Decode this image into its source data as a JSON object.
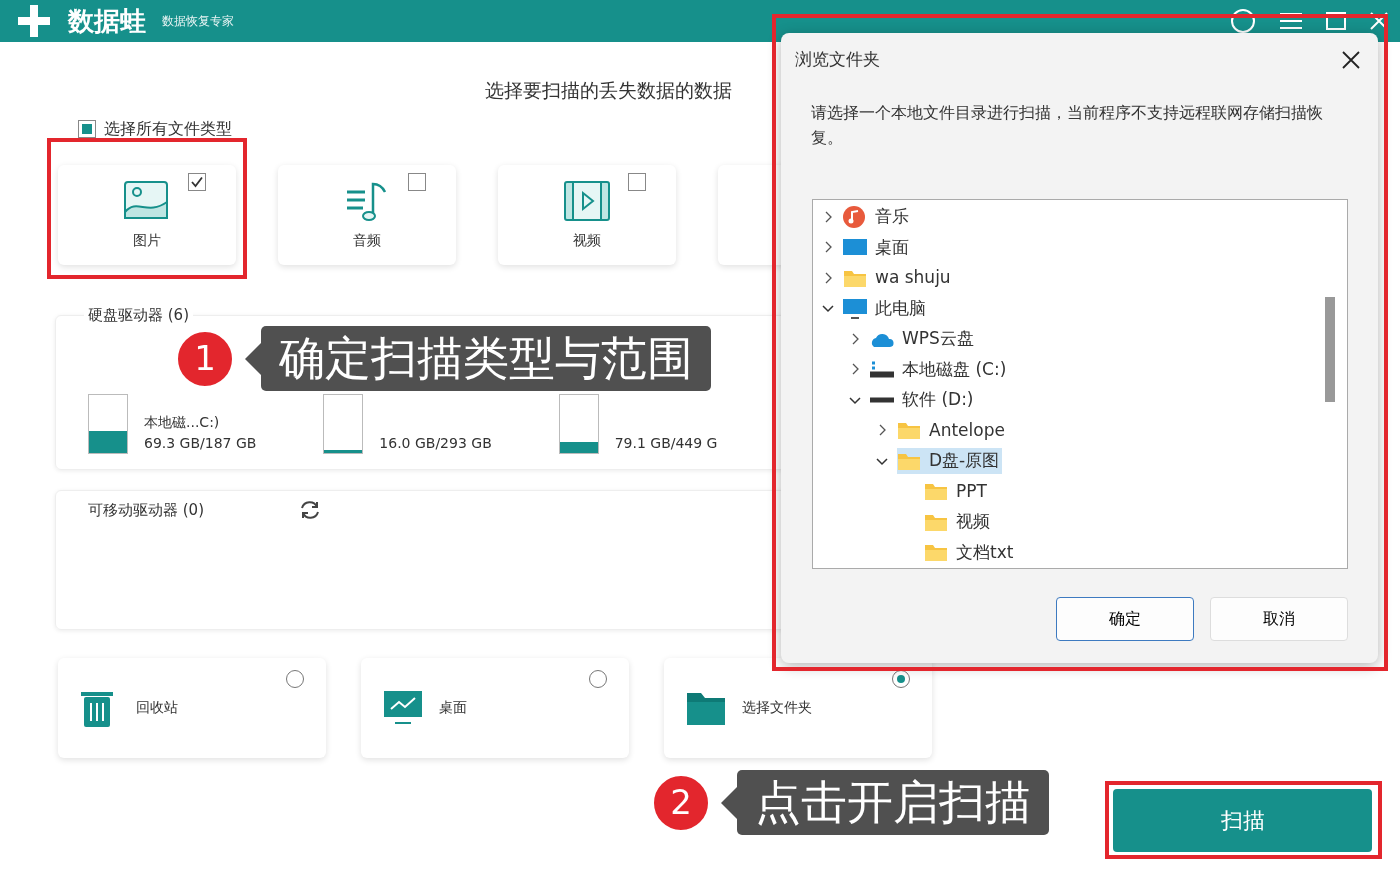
{
  "app": {
    "logo": "数据蛙",
    "subtitle": "数据恢复专家"
  },
  "heading": "选择要扫描的丢失数据的数据",
  "select_all": {
    "label": "选择所有文件类型",
    "indeterminate": true
  },
  "file_types": [
    {
      "label": "图片",
      "kind": "image",
      "checked": true,
      "highlighted": true
    },
    {
      "label": "音频",
      "kind": "audio",
      "checked": false,
      "highlighted": false
    },
    {
      "label": "视频",
      "kind": "video",
      "checked": false,
      "highlighted": false
    }
  ],
  "hard_drives": {
    "title": "硬盘驱动器 (6)",
    "drives": [
      {
        "name": "本地磁...C:)",
        "usage": "69.3 GB/187 GB",
        "level": 0.37
      },
      {
        "usage": "16.0 GB/293 GB",
        "level": 0.05
      },
      {
        "usage": "79.1 GB/449 G",
        "level": 0.18
      }
    ]
  },
  "removable": {
    "title": "可移动驱动器 (0)"
  },
  "locations": [
    {
      "label": "回收站",
      "kind": "trash",
      "selected": false
    },
    {
      "label": "桌面",
      "kind": "desktop",
      "selected": false
    },
    {
      "label": "选择文件夹",
      "kind": "folder",
      "selected": true
    }
  ],
  "scan_button": {
    "label": "扫描",
    "highlighted": true
  },
  "dialog": {
    "title": "浏览文件夹",
    "message": "请选择一个本地文件目录进行扫描，当前程序不支持远程联网存储扫描恢复。",
    "highlighted": true,
    "tree": [
      {
        "label": "音乐",
        "kind": "music",
        "expanded": false,
        "selected": false
      },
      {
        "label": "桌面",
        "kind": "desktop",
        "expanded": false,
        "selected": false
      },
      {
        "label": "wa shuju",
        "kind": "folder",
        "expanded": false,
        "selected": false
      },
      {
        "label": "此电脑",
        "kind": "pc",
        "expanded": true,
        "selected": false,
        "children": [
          {
            "label": "WPS云盘",
            "kind": "cloud",
            "expanded": false,
            "selected": false
          },
          {
            "label": "本地磁盘 (C:)",
            "kind": "system-drive",
            "expanded": false,
            "selected": false
          },
          {
            "label": "软件 (D:)",
            "kind": "drive",
            "expanded": true,
            "selected": false,
            "children": [
              {
                "label": "Antelope",
                "kind": "folder",
                "expanded": false,
                "selected": false
              },
              {
                "label": "D盘-原图",
                "kind": "folder",
                "expanded": true,
                "selected": true,
                "children": [
                  {
                    "label": "PPT",
                    "kind": "leaf-folder",
                    "selected": false
                  },
                  {
                    "label": "视频",
                    "kind": "leaf-folder",
                    "selected": false
                  },
                  {
                    "label": "文档txt",
                    "kind": "leaf-folder",
                    "selected": false
                  }
                ]
              }
            ]
          }
        ]
      }
    ],
    "buttons": [
      {
        "label": "确定",
        "kind": "primary"
      },
      {
        "label": "取消",
        "kind": "secondary"
      }
    ]
  },
  "callouts": [
    {
      "number": "1",
      "text": "确定扫描类型与范围"
    },
    {
      "number": "2",
      "text": "点击开启扫描"
    }
  ]
}
